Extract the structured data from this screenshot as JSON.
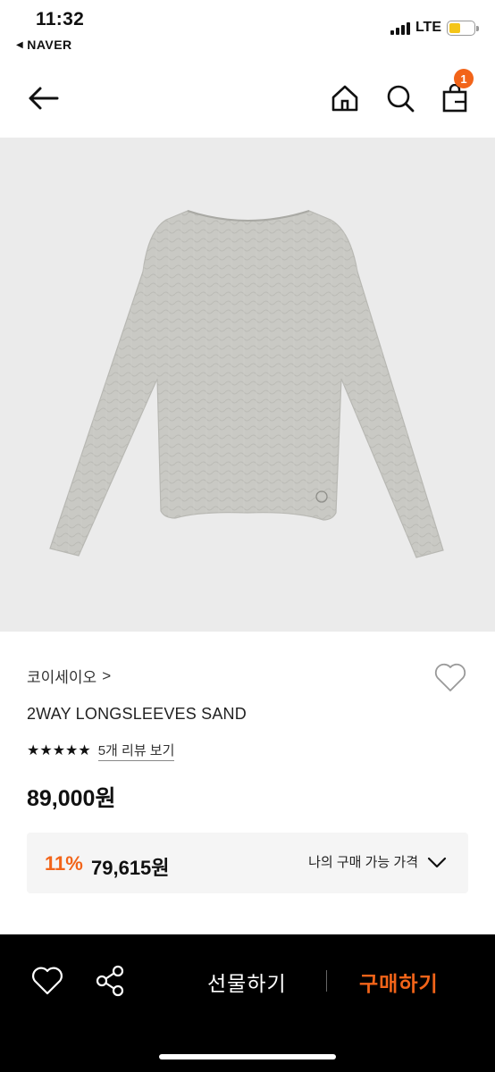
{
  "status_bar": {
    "time": "11:32",
    "back_app": "NAVER",
    "network": "LTE",
    "battery_level": 0.45
  },
  "nav": {
    "back_icon": "arrow-left-icon",
    "home_icon": "home-icon",
    "search_icon": "search-icon",
    "cart_icon": "shopping-bag-icon",
    "cart_count": "1"
  },
  "product": {
    "brand": "코이세이오",
    "brand_chevron": ">",
    "name": "2WAY LONGSLEEVES SAND",
    "rating": 5,
    "stars": "★★★★★",
    "review_link": "5개 리뷰 보기",
    "price": "89,000원",
    "discount_rate": "11%",
    "discount_price": "79,615원",
    "my_price_label": "나의 구매 가능 가격"
  },
  "bottom_bar": {
    "gift_label": "선물하기",
    "buy_label": "구매하기"
  },
  "colors": {
    "accent": "#f26419",
    "image_bg": "#ebebeb",
    "discount_box_bg": "#f5f5f5",
    "bottom_bar_bg": "#000000",
    "garment": "#c9c9c4"
  }
}
